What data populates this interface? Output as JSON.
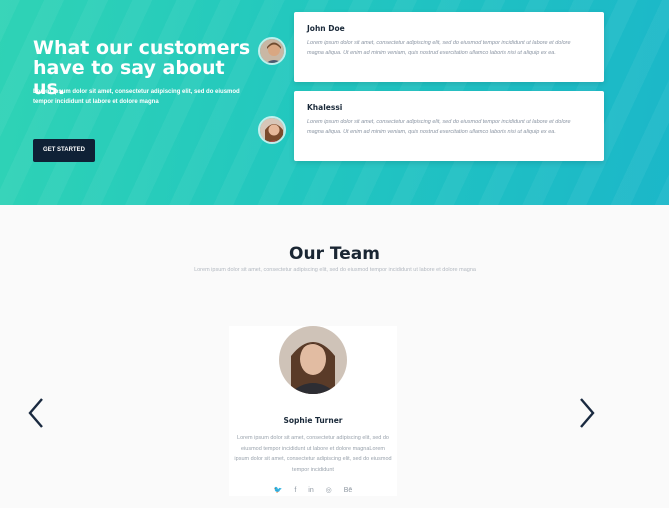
{
  "hero": {
    "title": "What our customers have to say about us.",
    "text": "Lorem ipsum dolor sit amet, consectetur adipiscing elit, sed do eiusmod tempor incididunt ut labore et dolore magna",
    "cta_label": "GET STARTED"
  },
  "testimonials": [
    {
      "name": "John Doe",
      "text": "Lorem ipsum dolor sit amet, consectetur adipiscing elit, sed do eiusmod tempor incididunt ut labore et dolore magna aliqua. Ut enim ad minim veniam, quis nostrud exercitation ullamco laboris nisi ut aliquip ex ea."
    },
    {
      "name": "Khalessi",
      "text": "Lorem ipsum dolor sit amet, consectetur adipiscing elit, sed do eiusmod tempor incididunt ut labore et dolore magna aliqua. Ut enim ad minim veniam, quis nostrud exercitation ullamco laboris nisi ut aliquip ex ea."
    }
  ],
  "team": {
    "title": "Our Team",
    "subtitle": "Lorem ipsum dolor sit amet, consectetur adipiscing elit, sed do eiusmod tempor incididunt ut labore et dolore magna",
    "member": {
      "name": "Sophie Turner",
      "bio": "Lorem ipsum dolor sit amet, consectetur adipiscing elit, sed do eiusmod tempor incididunt ut labore et dolore magnaLorem ipsum dolor sit amet, consectetur adipiscing elit, sed do eiusmod tempor incididunt"
    },
    "socials": {
      "twitter": "🐦",
      "facebook": "f",
      "linkedin": "in",
      "dribbble": "◎",
      "behance": "Bē"
    }
  },
  "colors": {
    "hero_start": "#2fd3b5",
    "hero_end": "#1bb7c9",
    "cta_bg": "#0f2136",
    "heading": "#1a2633"
  }
}
